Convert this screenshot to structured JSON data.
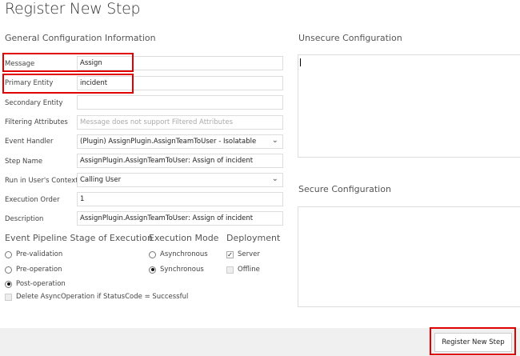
{
  "title": "Register New Step",
  "general_heading": "General Configuration Information",
  "fields": [
    {
      "label": "Message",
      "value": "Assign"
    },
    {
      "label": "Primary Entity",
      "value": "incident"
    },
    {
      "label": "Secondary Entity",
      "value": ""
    },
    {
      "label": "Filtering Attributes",
      "value": "",
      "placeholder": "Message does not support Filtered Attributes"
    },
    {
      "label": "Event Handler",
      "value": "(Plugin) AssignPlugin.AssignTeamToUser - Isolatable"
    },
    {
      "label": "Step Name",
      "value": "AssignPlugin.AssignTeamToUser: Assign of incident"
    },
    {
      "label": "Run in User's Context",
      "value": "Calling User"
    },
    {
      "label": "Execution Order",
      "value": "1"
    },
    {
      "label": "Description",
      "value": "AssignPlugin.AssignTeamToUser: Assign of incident"
    }
  ],
  "pipeline": {
    "heading": "Event Pipeline Stage of Execution",
    "options": [
      "Pre-validation",
      "Pre-operation",
      "Post-operation"
    ],
    "selected": "Post-operation"
  },
  "mode": {
    "heading": "Execution Mode",
    "options": [
      "Asynchronous",
      "Synchronous"
    ],
    "selected": "Synchronous"
  },
  "deployment": {
    "heading": "Deployment",
    "server": "Server",
    "server_checked": true,
    "offline": "Offline",
    "offline_checked": false
  },
  "delete_async": {
    "label": "Delete AsyncOperation if StatusCode = Successful",
    "checked": false
  },
  "unsecure_heading": "Unsecure  Configuration",
  "secure_heading": "Secure  Configuration",
  "register_button": "Register New Step",
  "colors": {
    "highlight": "#e00000",
    "footer": "#f0f0f0"
  }
}
